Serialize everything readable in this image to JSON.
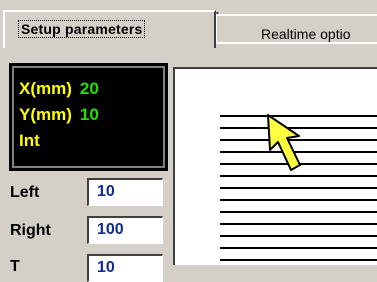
{
  "tabs": [
    {
      "label": "Setup parameters",
      "active": true
    },
    {
      "label": "Realtime optio",
      "active": false
    }
  ],
  "info": {
    "rows": [
      {
        "key": "X(mm)",
        "value": "20"
      },
      {
        "key": "Y(mm)",
        "value": "10"
      },
      {
        "key": "Int",
        "value": ""
      }
    ]
  },
  "fields": [
    {
      "label": "Left",
      "value": "10"
    },
    {
      "label": "Right",
      "value": "100"
    },
    {
      "label": "T",
      "value": "10"
    }
  ],
  "colors": {
    "accent_key": "#ffff00",
    "accent_value": "#20e000",
    "cursor": "#ffff40"
  },
  "cursor_icon": "arrow-pointer-icon"
}
